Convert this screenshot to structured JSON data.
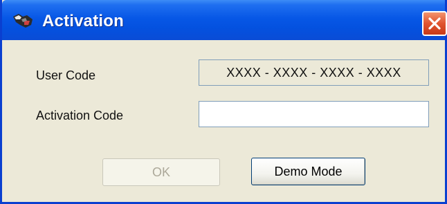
{
  "window": {
    "title": "Activation",
    "colors": {
      "titlebar": "#0757e6",
      "body": "#ece9d8",
      "close": "#e0542f"
    }
  },
  "form": {
    "user_code_label": "User Code",
    "user_code_value": "XXXX - XXXX - XXXX - XXXX",
    "activation_code_label": "Activation Code",
    "activation_code_value": ""
  },
  "buttons": {
    "ok_label": "OK",
    "ok_enabled": false,
    "demo_label": "Demo Mode"
  },
  "icons": {
    "app": "activation-app-icon",
    "close": "close-icon"
  }
}
